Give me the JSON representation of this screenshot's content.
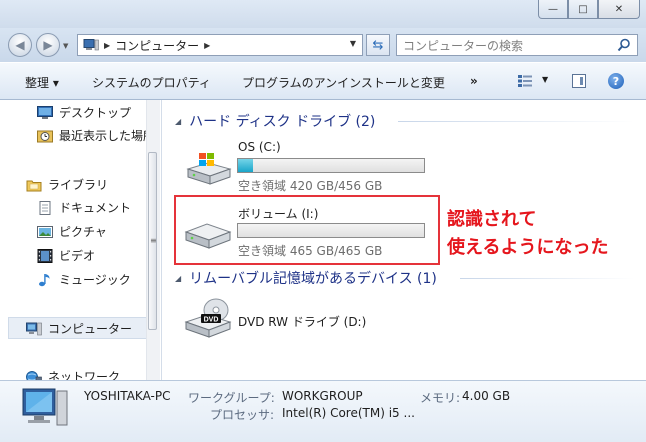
{
  "window": {
    "minimize": "—",
    "maximize": "□",
    "close": "✕"
  },
  "address": {
    "path": "コンピューター",
    "search_placeholder": "コンピューターの検索"
  },
  "toolbar": {
    "organize": "整理 ▾",
    "system_properties": "システムのプロパティ",
    "uninstall": "プログラムのアンインストールと変更",
    "more": "»"
  },
  "nav": {
    "items": [
      {
        "label": "デスクトップ",
        "icon": "desktop-icon"
      },
      {
        "label": "最近表示した場所",
        "icon": "recent-places-icon"
      },
      {
        "label": "ライブラリ",
        "icon": "library-icon"
      },
      {
        "label": "ドキュメント",
        "icon": "documents-icon"
      },
      {
        "label": "ピクチャ",
        "icon": "pictures-icon"
      },
      {
        "label": "ビデオ",
        "icon": "videos-icon"
      },
      {
        "label": "ミュージック",
        "icon": "music-icon"
      },
      {
        "label": "コンピューター",
        "icon": "computer-icon"
      },
      {
        "label": "ネットワーク",
        "icon": "network-icon"
      }
    ]
  },
  "groups": {
    "hdd": "ハード ディスク ドライブ (2)",
    "removable": "リムーバブル記憶域があるデバイス (1)"
  },
  "drives": {
    "c": {
      "name": "OS (C:)",
      "free": "空き領域 420 GB/456 GB",
      "used_fraction": 0.079
    },
    "i": {
      "name": "ボリューム (I:)",
      "free": "空き領域 465 GB/465 GB",
      "used_fraction": 0.0
    },
    "dvd": {
      "name": "DVD RW ドライブ (D:)",
      "badge": "DVD"
    }
  },
  "annotation": {
    "line1": "認識されて",
    "line2": "使えるようになった"
  },
  "details": {
    "pc_name": "YOSHITAKA-PC",
    "workgroup_label": "ワークグループ:",
    "workgroup": "WORKGROUP",
    "memory_label": "メモリ:",
    "memory": "4.00 GB",
    "processor_label": "プロセッサ:",
    "processor": "Intel(R) Core(TM) i5 ..."
  },
  "colors": {
    "group_header": "#1e3287",
    "annotation": "#e5161d",
    "bar_fill": "#1aa5c9"
  }
}
